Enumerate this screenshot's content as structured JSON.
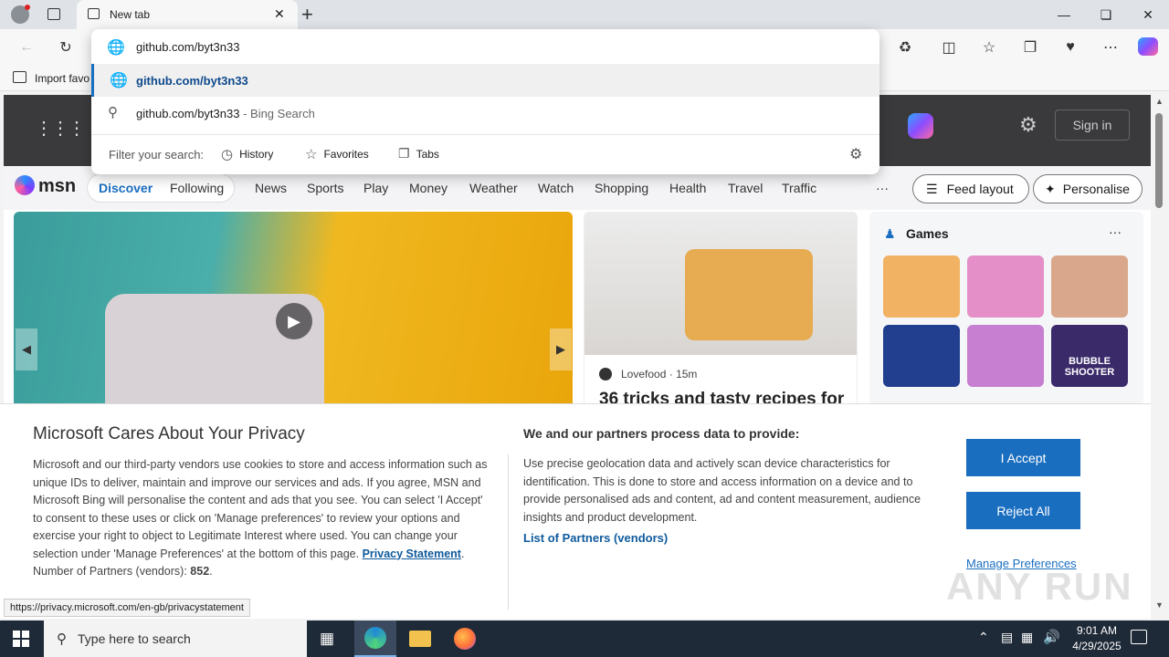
{
  "browser": {
    "tab_title": "New tab",
    "new_tab_symbol": "+",
    "favorites_bar_label": "Import favo"
  },
  "omnibox": {
    "value": "github.com/byt3n33",
    "suggestions": [
      {
        "text": "github.com/byt3n33",
        "suffix": ""
      },
      {
        "text": "github.com/byt3n33",
        "suffix": " - Bing Search"
      }
    ],
    "filter_label": "Filter your search:",
    "filters": [
      "History",
      "Favorites",
      "Tabs"
    ]
  },
  "msn": {
    "logo": "msn",
    "sign_in": "Sign in",
    "nav": [
      "Discover",
      "Following",
      "News",
      "Sports",
      "Play",
      "Money",
      "Weather",
      "Watch",
      "Shopping",
      "Health",
      "Travel",
      "Traffic"
    ],
    "more": "···",
    "feed_layout": "Feed layout",
    "personalise": "Personalise",
    "article_source": "Lovefood",
    "article_time": "15m",
    "article_title": "36 tricks and tasty recipes for",
    "games_title": "Games",
    "games_more": "···",
    "bubble_game_label": "BUBBLE SHOOTER"
  },
  "privacy": {
    "title": "Microsoft Cares About Your Privacy",
    "body": "Microsoft and our third-party vendors use cookies to store and access information such as unique IDs to deliver, maintain and improve our services and ads. If you agree, MSN and Microsoft Bing will personalise the content and ads that you see. You can select 'I Accept' to consent to these uses or click on 'Manage preferences' to review your options and exercise your right to object to Legitimate Interest where used.  You can change your selection under 'Manage Preferences' at the bottom of this page.",
    "privacy_link": "Privacy Statement",
    "vendors_label": "Number of Partners (vendors):",
    "vendors_count": "852",
    "right_title": "We and our partners process data to provide:",
    "right_body": "Use precise geolocation data and actively scan device characteristics for identification. This is done to store and access information on a device and to provide personalised ads and content, ad and content measurement, audience insights and product development.",
    "partners_link": "List of Partners (vendors)",
    "accept": "I Accept",
    "reject": "Reject All",
    "manage": "Manage Preferences"
  },
  "status_bar": "https://privacy.microsoft.com/en-gb/privacystatement",
  "watermark": "ANY RUN",
  "taskbar": {
    "search_placeholder": "Type here to search",
    "time": "9:01 AM",
    "date": "4/29/2025"
  },
  "colors": {
    "accent": "#1a6ec0",
    "taskbar": "#1f2a38"
  }
}
